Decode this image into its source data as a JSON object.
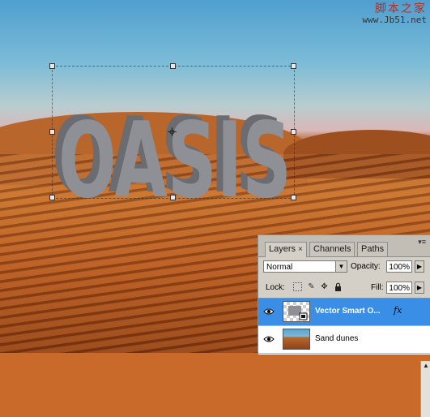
{
  "watermark": {
    "site_name_cn": "脚本之家",
    "url": "www.Jb51.net"
  },
  "artwork": {
    "text": "OASIS",
    "fill_color": "#8e9096",
    "side_color": "#6a6c72"
  },
  "layers_panel": {
    "tabs": [
      {
        "label": "Layers",
        "active": true,
        "close": "×"
      },
      {
        "label": "Channels",
        "active": false
      },
      {
        "label": "Paths",
        "active": false
      }
    ],
    "menu_icon": "panel-menu-icon",
    "blend_mode": "Normal",
    "opacity_label": "Opacity:",
    "opacity_value": "100%",
    "lock_label": "Lock:",
    "fill_label": "Fill:",
    "fill_value": "100%",
    "layers": [
      {
        "name": "Vector Smart O...",
        "selected": true,
        "fx": "fx",
        "visible": true
      },
      {
        "name": "Sand dunes",
        "selected": false,
        "visible": true
      }
    ]
  },
  "colors": {
    "selection_blue": "#3a8ee6",
    "panel_gray": "#d4d0c8"
  }
}
